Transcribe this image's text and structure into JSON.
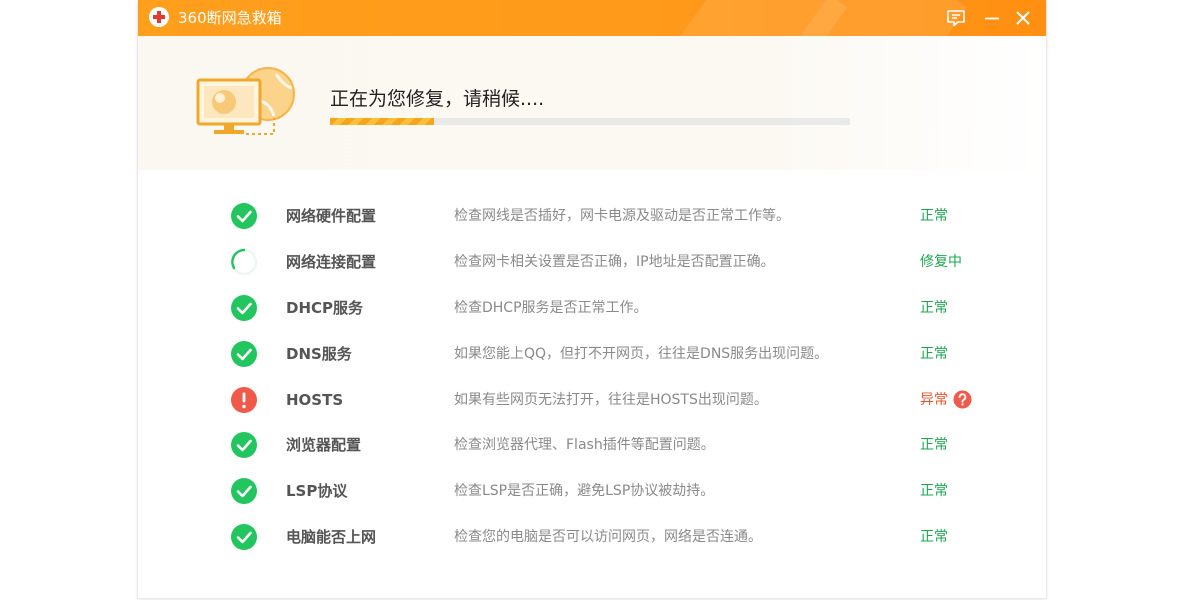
{
  "app": {
    "title": "360断网急救箱",
    "accent_color": "#ff9a1a",
    "icons": {
      "logo": "red-cross-logo-icon",
      "feedback": "feedback-icon",
      "minimize": "minimize-icon",
      "close": "close-icon"
    }
  },
  "banner": {
    "status_text": "正在为您修复，请稍候....",
    "progress": 0.2,
    "illustration": "monitor-globe-icon"
  },
  "colors": {
    "ok": "#1aa84f",
    "error": "#e8542e",
    "ok_icon": "#22c55e",
    "error_icon": "#f05a4a"
  },
  "checks": [
    {
      "name": "网络硬件配置",
      "description": "检查网线是否插好，网卡电源及驱动是否正常工作等。",
      "result": "正常",
      "state": "ok"
    },
    {
      "name": "网络连接配置",
      "description": "检查网卡相关设置是否正确，IP地址是否配置正确。",
      "result": "修复中",
      "state": "repairing"
    },
    {
      "name": "DHCP服务",
      "description": "检查DHCP服务是否正常工作。",
      "result": "正常",
      "state": "ok"
    },
    {
      "name": "DNS服务",
      "description": "如果您能上QQ，但打不开网页，往往是DNS服务出现问题。",
      "result": "正常",
      "state": "ok"
    },
    {
      "name": "HOSTS",
      "description": "如果有些网页无法打开，往往是HOSTS出现问题。",
      "result": "异常",
      "state": "error"
    },
    {
      "name": "浏览器配置",
      "description": "检查浏览器代理、Flash插件等配置问题。",
      "result": "正常",
      "state": "ok"
    },
    {
      "name": "LSP协议",
      "description": "检查LSP是否正确，避免LSP协议被劫持。",
      "result": "正常",
      "state": "ok"
    },
    {
      "name": "电脑能否上网",
      "description": "检查您的电脑是否可以访问网页，网络是否连通。",
      "result": "正常",
      "state": "ok"
    }
  ]
}
